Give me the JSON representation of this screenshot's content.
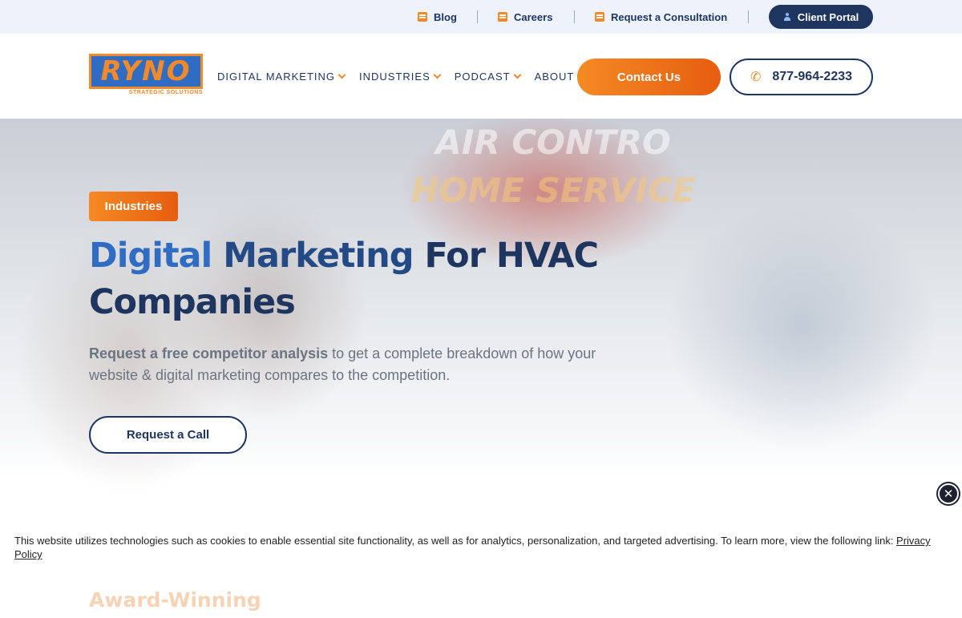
{
  "topbar": {
    "blog": "Blog",
    "careers": "Careers",
    "consultation": "Request a Consultation",
    "client_portal": "Client Portal"
  },
  "nav": {
    "logo_text": "RYNO",
    "logo_sub": "STRATEGIC SOLUTIONS",
    "items": [
      {
        "label": "DIGITAL MARKETING"
      },
      {
        "label": "INDUSTRIES"
      },
      {
        "label": "PODCAST"
      },
      {
        "label": "ABOUT"
      }
    ],
    "contact_label": "Contact Us",
    "phone": "877-964-2233"
  },
  "hero": {
    "banner_line1": "AIR CONTRO",
    "banner_line2": "HOME SERVICE",
    "badge": "Industries",
    "title_part1": "Digital ",
    "title_part2": "Marketing",
    "title_part3": " For HVAC Companies",
    "desc_bold": "Request a free competitor analysis",
    "desc_rest": " to get a complete breakdown of how your website & digital marketing compares to the competition.",
    "cta": "Request a Call"
  },
  "cookie": {
    "text": "This website utilizes technologies such as cookies to enable essential site functionality, as well as for analytics, personalization, and targeted advertising. To learn more, view the following link: ",
    "link": "Privacy Policy",
    "close": "✕"
  },
  "section": {
    "award_heading": "Award-Winning"
  },
  "colors": {
    "navy": "#1e3560",
    "orange": "#f08a2a",
    "blue": "#2f6cc2"
  }
}
